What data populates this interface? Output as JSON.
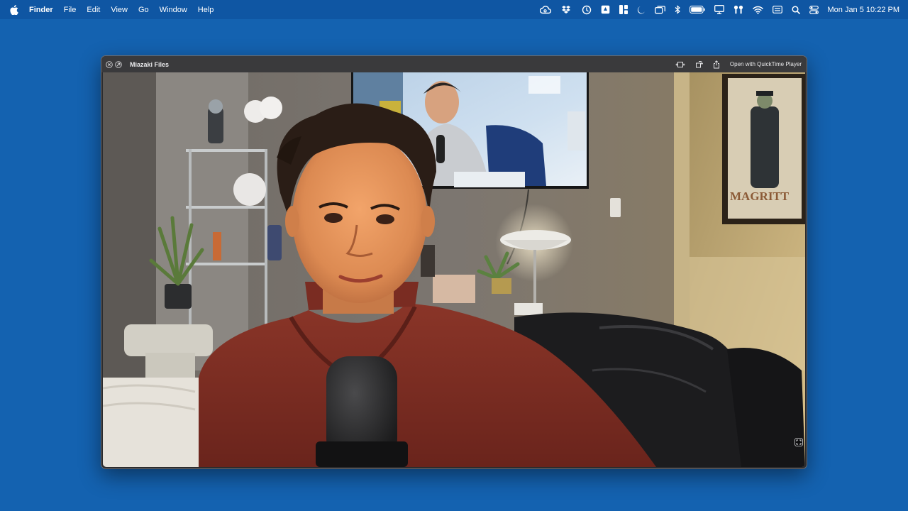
{
  "menubar": {
    "app_name": "Finder",
    "menus": [
      "File",
      "Edit",
      "View",
      "Go",
      "Window",
      "Help"
    ],
    "status_icons": [
      "creative-cloud-icon",
      "dropbox-icon",
      "sync-icon",
      "google-drive-icon",
      "app-switcher-icon",
      "focus-moon-icon",
      "screen-mirror-icon",
      "bluetooth-icon",
      "battery-icon",
      "display-icon",
      "airpods-icon",
      "wifi-icon",
      "keyboard-icon",
      "search-icon",
      "control-center-icon"
    ],
    "clock": "Mon Jan 5  10:22 PM"
  },
  "window": {
    "title": "Miazaki Files",
    "open_with_label": "Open with QuickTime Player",
    "poster_text": "MAGRITT"
  },
  "colors": {
    "desktop": "#1462b0",
    "menubar": "#0f56a3",
    "titlebar": "#3a3a3c",
    "sweater": "#7a2c22"
  }
}
